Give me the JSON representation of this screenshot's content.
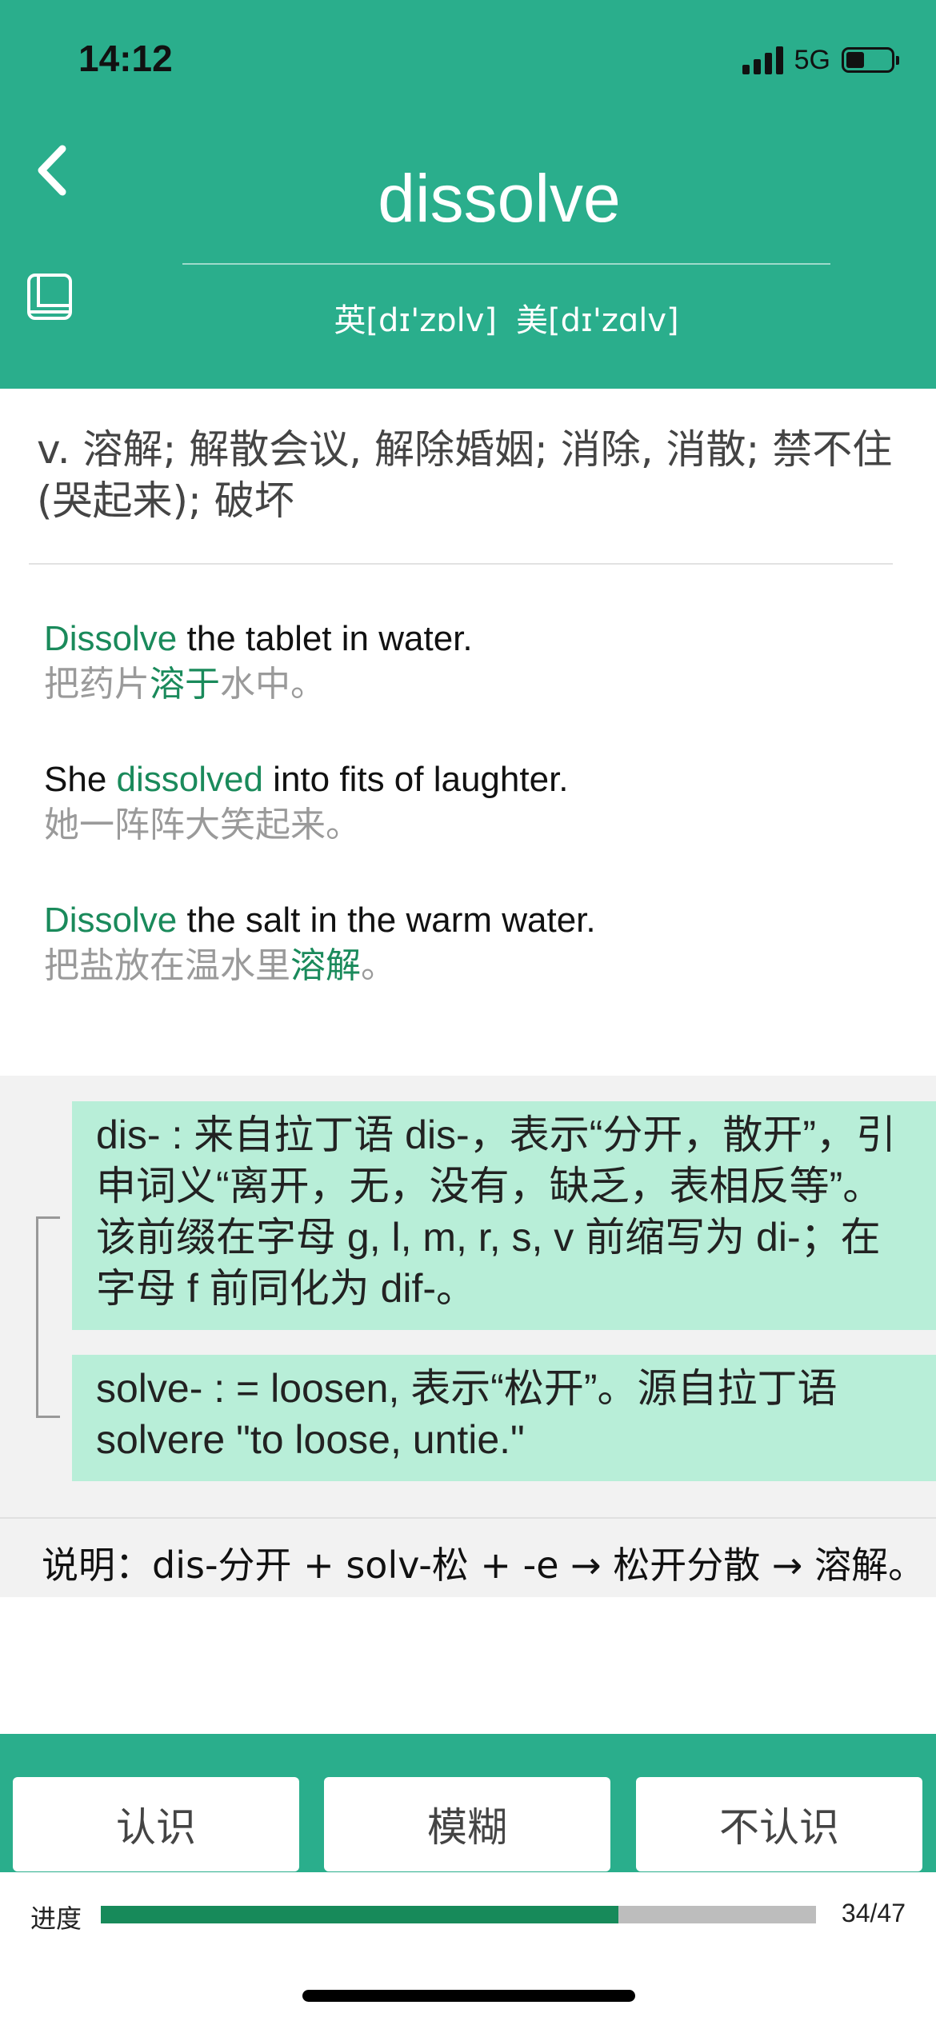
{
  "status_bar": {
    "time": "14:12",
    "network": "5G",
    "battery_level": 0.4
  },
  "colors": {
    "accent": "#2AAE8C",
    "highlight": "#1A8A5B",
    "morph_bg": "#B8EED8",
    "progress": "#178A5A"
  },
  "header": {
    "back_icon": "chevron-left-icon",
    "book_icon": "book-icon",
    "word": "dissolve",
    "phonetic_uk": "英[dɪ'zɒlv]",
    "phonetic_us": "美[dɪ'zɑlv]"
  },
  "definition": "v. 溶解; 解散会议, 解除婚姻; 消除, 消散; 禁不住 (哭起来); 破坏",
  "examples": [
    {
      "en": [
        {
          "t": "Dissolve",
          "h": true
        },
        {
          "t": " the tablet in water.",
          "h": false
        }
      ],
      "cn": [
        {
          "t": "把药片",
          "h": false
        },
        {
          "t": "溶于",
          "h": true
        },
        {
          "t": "水中。",
          "h": false
        }
      ]
    },
    {
      "en": [
        {
          "t": "She ",
          "h": false
        },
        {
          "t": "dissolved",
          "h": true
        },
        {
          "t": " into fits of laughter.",
          "h": false
        }
      ],
      "cn": [
        {
          "t": "她一阵阵大笑起来。",
          "h": false
        }
      ]
    },
    {
      "en": [
        {
          "t": "Dissolve",
          "h": true
        },
        {
          "t": " the salt in the warm water.",
          "h": false
        }
      ],
      "cn": [
        {
          "t": "把盐放在温水里",
          "h": false
        },
        {
          "t": "溶解",
          "h": true
        },
        {
          "t": "。",
          "h": false
        }
      ]
    }
  ],
  "etymology": {
    "prefix_text": "dis- : 来自拉丁语 dis-，表示“分开，散开”，引申词义“离开，无，没有，缺乏，表相反等”。该前缀在字母 g, l, m, r, s, v 前缩写为 di-；在字母 f 前同化为 dif-。",
    "root_text": "solve- : = loosen, 表示“松开”。源自拉丁语 solvere \"to loose, untie.\""
  },
  "explanation": "说明：dis-分开 + solv-松 + -e → 松开分散 → 溶解。",
  "actions": {
    "know": "认识",
    "vague": "模糊",
    "unknown": "不认识"
  },
  "progress": {
    "label": "进度",
    "current": 34,
    "total": 47,
    "text": "34/47"
  }
}
